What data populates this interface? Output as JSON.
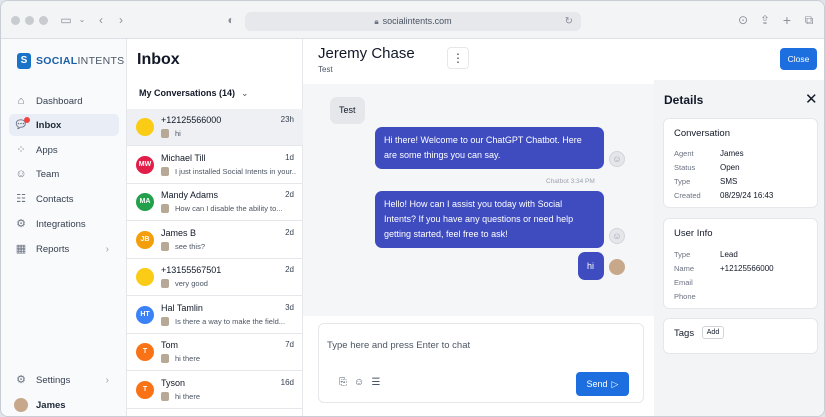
{
  "browser": {
    "url": "socialintents.com"
  },
  "brand": {
    "logo_text_strong": "SOCIAL",
    "logo_text_light": "INTENTS",
    "accent": "#1d6fe0",
    "bubble_out": "#3f4cc0"
  },
  "sidebar": {
    "items": [
      {
        "label": "Dashboard",
        "icon": "home-icon"
      },
      {
        "label": "Inbox",
        "icon": "chat-icon"
      },
      {
        "label": "Apps",
        "icon": "apps-icon"
      },
      {
        "label": "Team",
        "icon": "team-icon"
      },
      {
        "label": "Contacts",
        "icon": "contacts-icon"
      },
      {
        "label": "Integrations",
        "icon": "integrations-icon"
      },
      {
        "label": "Reports",
        "icon": "reports-icon"
      }
    ],
    "settings_label": "Settings",
    "user_name": "James"
  },
  "inbox": {
    "title": "Inbox",
    "filter_label": "My Conversations (14)",
    "conversations": [
      {
        "initials": "",
        "name": "+12125566000",
        "time": "23h",
        "preview": "hi",
        "color": "#facc15"
      },
      {
        "initials": "MW",
        "name": "Michael Till",
        "time": "1d",
        "preview": "I just installed Social Intents in your...",
        "color": "#e11d48"
      },
      {
        "initials": "MA",
        "name": "Mandy Adams",
        "time": "2d",
        "preview": "How can I disable the ability to...",
        "color": "#22a04b"
      },
      {
        "initials": "JB",
        "name": "James B",
        "time": "2d",
        "preview": "see this?",
        "color": "#f59e0b"
      },
      {
        "initials": "",
        "name": "+13155567501",
        "time": "2d",
        "preview": "very good",
        "color": "#facc15"
      },
      {
        "initials": "HT",
        "name": "Hal Tamlin",
        "time": "3d",
        "preview": "Is there a way to make the field...",
        "color": "#3b82f6"
      },
      {
        "initials": "T",
        "name": "Tom",
        "time": "7d",
        "preview": "hi there",
        "color": "#f97316"
      },
      {
        "initials": "T",
        "name": "Tyson",
        "time": "16d",
        "preview": "hi there",
        "color": "#f97316"
      }
    ]
  },
  "chat": {
    "contact_name": "Jeremy Chase",
    "contact_sub": "Test",
    "close_label": "Close",
    "messages": [
      {
        "text": "Test"
      },
      {
        "text": "Hi there! Welcome to our ChatGPT Chatbot. Here are some things you can say."
      },
      {
        "meta": "Chatbot  3:34 PM"
      },
      {
        "text": "Hello! How can I assist you today with Social Intents? If you have any questions or need help getting started, feel free to ask!"
      },
      {
        "text": "hi"
      }
    ],
    "composer_placeholder": "Type here and press Enter to chat",
    "send_label": "Send"
  },
  "details": {
    "title": "Details",
    "conversation": {
      "title": "Conversation",
      "rows": [
        {
          "key": "Agent",
          "value": "James"
        },
        {
          "key": "Status",
          "value": "Open"
        },
        {
          "key": "Type",
          "value": "SMS"
        },
        {
          "key": "Created",
          "value": "08/29/24 16:43"
        }
      ]
    },
    "user_info": {
      "title": "User Info",
      "rows": [
        {
          "key": "Type",
          "value": "Lead"
        },
        {
          "key": "Name",
          "value": "+12125566000"
        },
        {
          "key": "Email",
          "value": ""
        },
        {
          "key": "Phone",
          "value": ""
        }
      ]
    },
    "tags": {
      "title": "Tags",
      "add_label": "Add"
    }
  }
}
